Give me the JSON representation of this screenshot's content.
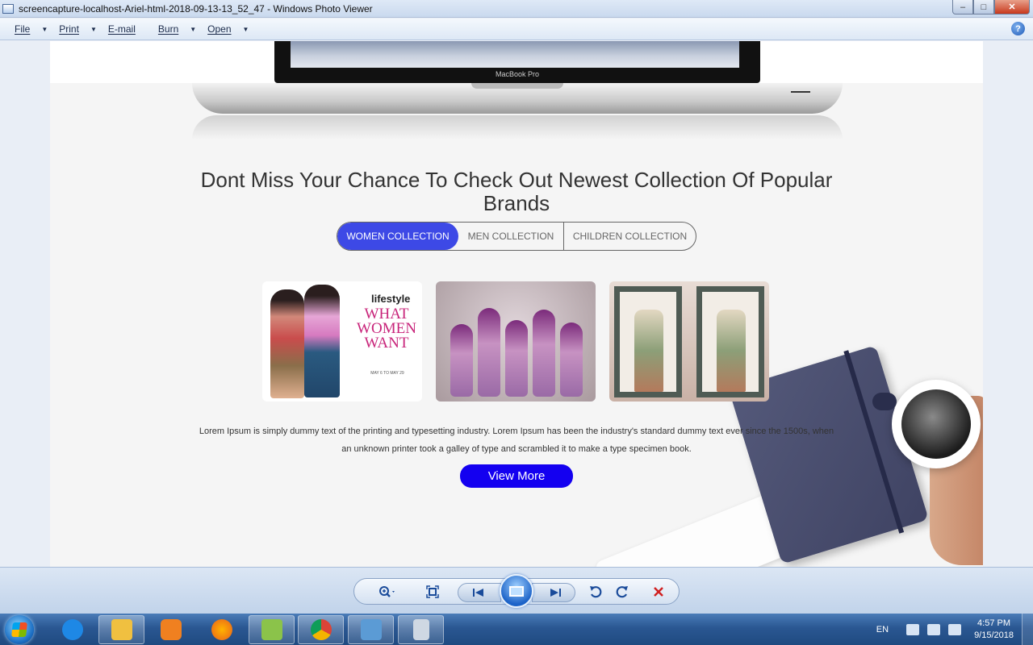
{
  "window": {
    "title": "screencapture-localhost-Ariel-html-2018-09-13-13_52_47 - Windows Photo Viewer",
    "controls": {
      "minimize": "–",
      "maximize": "□",
      "close": "✕"
    }
  },
  "menubar": {
    "items": [
      {
        "label": "File",
        "has_dropdown": true
      },
      {
        "label": "Print",
        "has_dropdown": true
      },
      {
        "label": "E-mail",
        "has_dropdown": false
      },
      {
        "label": "Burn",
        "has_dropdown": true
      },
      {
        "label": "Open",
        "has_dropdown": true
      }
    ],
    "help": "?"
  },
  "page": {
    "laptop_model": "MacBook Pro",
    "headline": "Dont Miss Your Chance To Check Out Newest Collection Of Popular Brands",
    "tabs": [
      {
        "label": "WOMEN COLLECTION",
        "active": true
      },
      {
        "label": "MEN COLLECTION",
        "active": false
      },
      {
        "label": "CHILDREN COLLECTION",
        "active": false
      }
    ],
    "gallery": [
      {
        "brand": "lifestyle",
        "headline": "WHAT WOMEN WANT",
        "dates": "MAY 6 TO MAY 29"
      },
      {},
      {}
    ],
    "body_text": "Lorem Ipsum is simply dummy text of the printing and typesetting industry. Lorem Ipsum has been the industry's standard dummy text ever since the 1500s, when an unknown printer took a galley of type and scrambled it to make a type specimen book.",
    "button": "View More"
  },
  "toolbar": {
    "icons": [
      "zoom-icon",
      "fit-to-window-icon",
      "previous-icon",
      "slideshow-icon",
      "next-icon",
      "rotate-counterclockwise-icon",
      "rotate-clockwise-icon",
      "delete-icon"
    ]
  },
  "taskbar": {
    "language": "EN",
    "time": "4:57 PM",
    "date": "9/15/2018",
    "colors": {
      "ie": "#1e88e5",
      "explorer": "#f0c040",
      "media": "#f08020",
      "firefox": "#e8601c",
      "notepadpp": "#8bc34a",
      "chrome": "#db4437",
      "photo": "#5b9bd5",
      "calc": "#cfd8e3"
    }
  }
}
